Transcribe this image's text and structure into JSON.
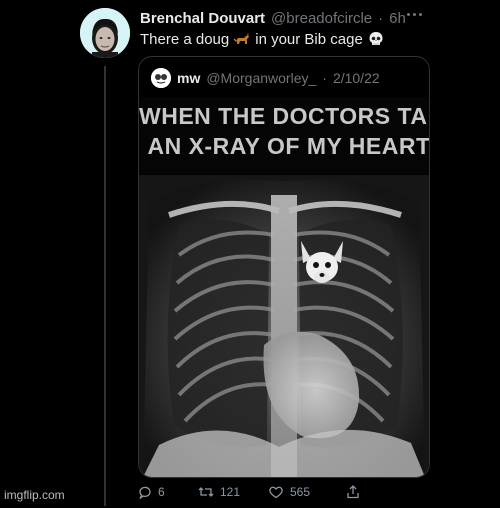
{
  "tweet": {
    "author_name": "Brenchal Douvart",
    "author_handle": "@breadofcircle",
    "separator": "·",
    "time": "6h",
    "text_before": "There a doug",
    "text_after": "in your Bib cage",
    "emoji_1": "dog-emoji",
    "emoji_2": "skull-emoji"
  },
  "quoted_tweet": {
    "author_name": "mw",
    "author_handle": "@Morganworley_",
    "separator": "·",
    "date": "2/10/22",
    "meme_line_1": "WHEN THE DOCTORS TAKES",
    "meme_line_2": "AN X-RAY OF MY HEART"
  },
  "actions": {
    "replies": "6",
    "retweets": "121",
    "likes": "565"
  },
  "watermark": "imgflip.com",
  "colors": {
    "background": "#000000",
    "text_primary": "#e7e9ea",
    "text_secondary": "#71767b",
    "border": "#2f3336"
  }
}
